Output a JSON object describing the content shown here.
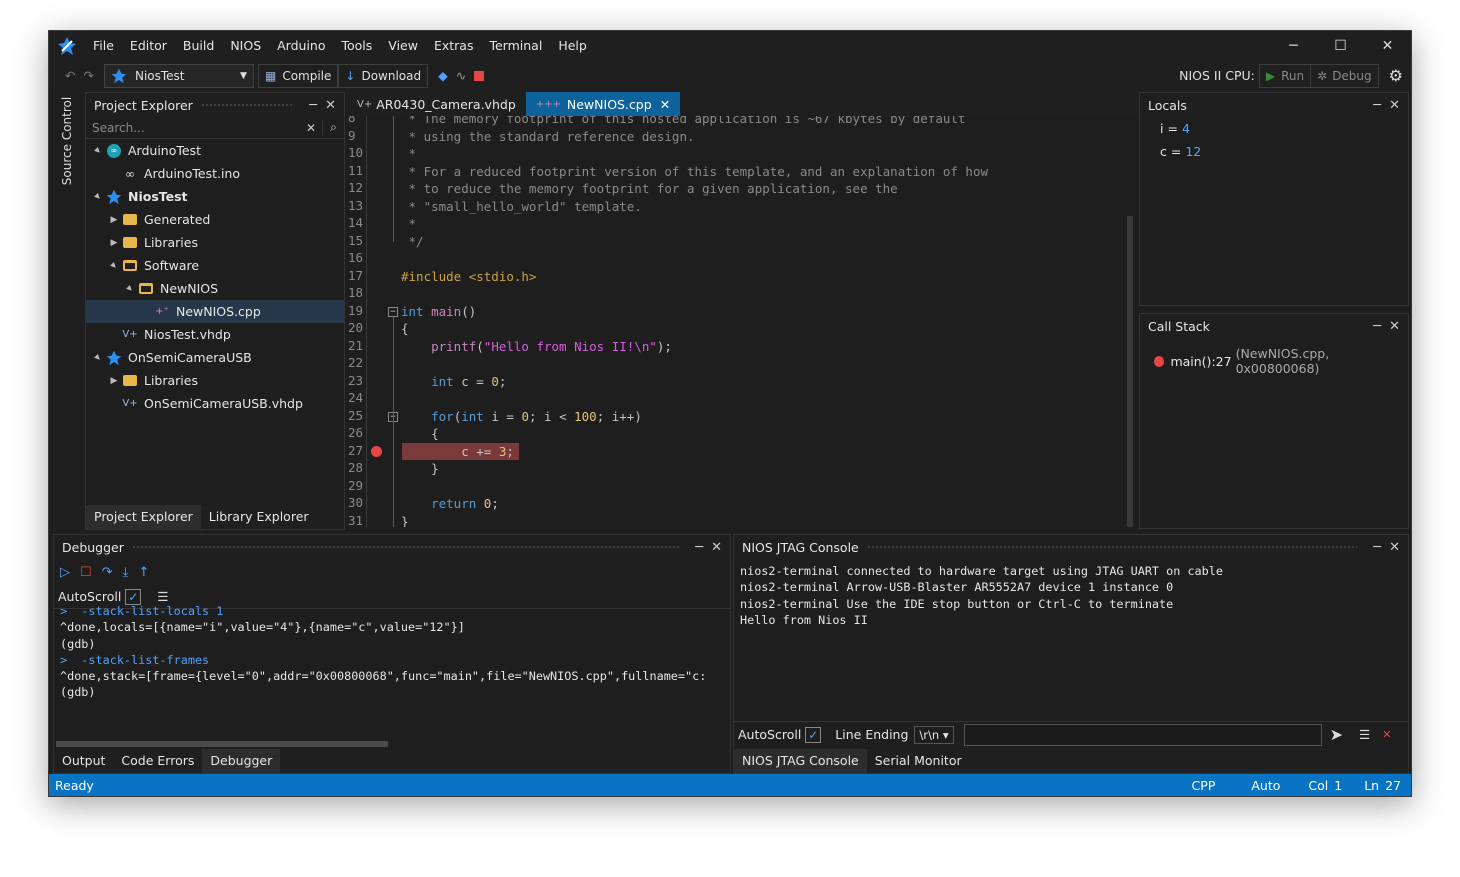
{
  "menu": [
    "File",
    "Editor",
    "Build",
    "NIOS",
    "Arduino",
    "Tools",
    "View",
    "Extras",
    "Terminal",
    "Help"
  ],
  "toolbar": {
    "project": "NiosTest",
    "compile": "Compile",
    "download": "Download",
    "cpu_label": "NIOS II CPU:",
    "run": "Run",
    "debug": "Debug"
  },
  "side_tab": "Source Control",
  "project_explorer": {
    "title": "Project Explorer",
    "search_placeholder": "Search...",
    "items": [
      {
        "label": "ArduinoTest",
        "depth": 0,
        "arrow": "▲",
        "icon": "arduino"
      },
      {
        "label": "ArduinoTest.ino",
        "depth": 1,
        "arrow": "",
        "icon": "ino"
      },
      {
        "label": "NiosTest",
        "depth": 0,
        "arrow": "▲",
        "icon": "nios",
        "bold": true
      },
      {
        "label": "Generated",
        "depth": 1,
        "arrow": "▶",
        "icon": "folder"
      },
      {
        "label": "Libraries",
        "depth": 1,
        "arrow": "▶",
        "icon": "folder"
      },
      {
        "label": "Software",
        "depth": 1,
        "arrow": "▲",
        "icon": "folder-open"
      },
      {
        "label": "NewNIOS",
        "depth": 2,
        "arrow": "▲",
        "icon": "folder-open"
      },
      {
        "label": "NewNIOS.cpp",
        "depth": 3,
        "arrow": "",
        "icon": "cpp",
        "selected": true
      },
      {
        "label": "NiosTest.vhdp",
        "depth": 1,
        "arrow": "",
        "icon": "vhdp"
      },
      {
        "label": "OnSemiCameraUSB",
        "depth": 0,
        "arrow": "▲",
        "icon": "nios"
      },
      {
        "label": "Libraries",
        "depth": 1,
        "arrow": "▶",
        "icon": "folder"
      },
      {
        "label": "OnSemiCameraUSB.vhdp",
        "depth": 1,
        "arrow": "",
        "icon": "vhdp"
      }
    ],
    "tabs": [
      "Project Explorer",
      "Library Explorer"
    ]
  },
  "editor": {
    "tabs": [
      {
        "label": "AR0430_Camera.vhdp",
        "active": false
      },
      {
        "label": "NewNIOS.cpp",
        "active": true
      }
    ],
    "line_numbers": [
      "8",
      "9",
      "10",
      "11",
      "12",
      "13",
      "14",
      "15",
      "16",
      "17",
      "18",
      "19",
      "20",
      "21",
      "22",
      "23",
      "24",
      "25",
      "26",
      "27",
      "28",
      "29",
      "30",
      "31"
    ],
    "lines": [
      " * The memory footprint of this hosted application is ~67 kbytes by default",
      " * using the standard reference design.",
      " *",
      " * For a reduced footprint version of this template, and an explanation of how",
      " * to reduce the memory footprint for a given application, see the",
      " * \"small_hello_world\" template.",
      " *",
      " */",
      "",
      "#include <stdio.h>",
      "",
      "int main()",
      "{",
      "    printf(\"Hello from Nios II!\\n\");",
      "",
      "    int c = 0;",
      "",
      "    for(int i = 0; i < 100; i++)",
      "    {",
      "        c += 3;",
      "    }",
      "",
      "    return 0;",
      "}"
    ]
  },
  "locals": {
    "title": "Locals",
    "vars": [
      {
        "name": "i",
        "value": "4"
      },
      {
        "name": "c",
        "value": "12"
      }
    ]
  },
  "call_stack": {
    "title": "Call Stack",
    "frames": [
      {
        "func": "main():27",
        "detail": "(NewNIOS.cpp, 0x00800068)"
      }
    ]
  },
  "debugger": {
    "title": "Debugger",
    "autoscroll": "AutoScroll",
    "lines": [
      {
        "text": ">  -stack-list-locals 1",
        "cmd": true
      },
      {
        "text": "^done,locals=[{name=\"i\",value=\"4\"},{name=\"c\",value=\"12\"}]",
        "cmd": false
      },
      {
        "text": "(gdb)",
        "cmd": false
      },
      {
        "text": ">  -stack-list-frames",
        "cmd": true
      },
      {
        "text": "^done,stack=[frame={level=\"0\",addr=\"0x00800068\",func=\"main\",file=\"NewNIOS.cpp\",fullname=\"c:",
        "cmd": false
      },
      {
        "text": "(gdb)",
        "cmd": false
      }
    ],
    "tabs": [
      "Output",
      "Code Errors",
      "Debugger"
    ]
  },
  "jtag": {
    "title": "NIOS JTAG Console",
    "lines": [
      "nios2-terminal connected to hardware target using JTAG UART on cable",
      "nios2-terminal Arrow-USB-Blaster AR5552A7 device 1 instance 0",
      "nios2-terminal Use the IDE stop button or Ctrl-C to terminate",
      "Hello from Nios II"
    ],
    "autoscroll": "AutoScroll",
    "line_ending_label": "Line Ending",
    "line_ending_value": "\\r\\n",
    "tabs": [
      "NIOS JTAG Console",
      "Serial Monitor"
    ]
  },
  "status": {
    "left": "Ready",
    "lang": "CPP",
    "mode": "Auto",
    "col_label": "Col",
    "col": "1",
    "ln_label": "Ln",
    "ln": "27"
  },
  "colors": {
    "accent": "#0a74c4",
    "breakpoint": "#e64545",
    "selection": "#26374a"
  }
}
